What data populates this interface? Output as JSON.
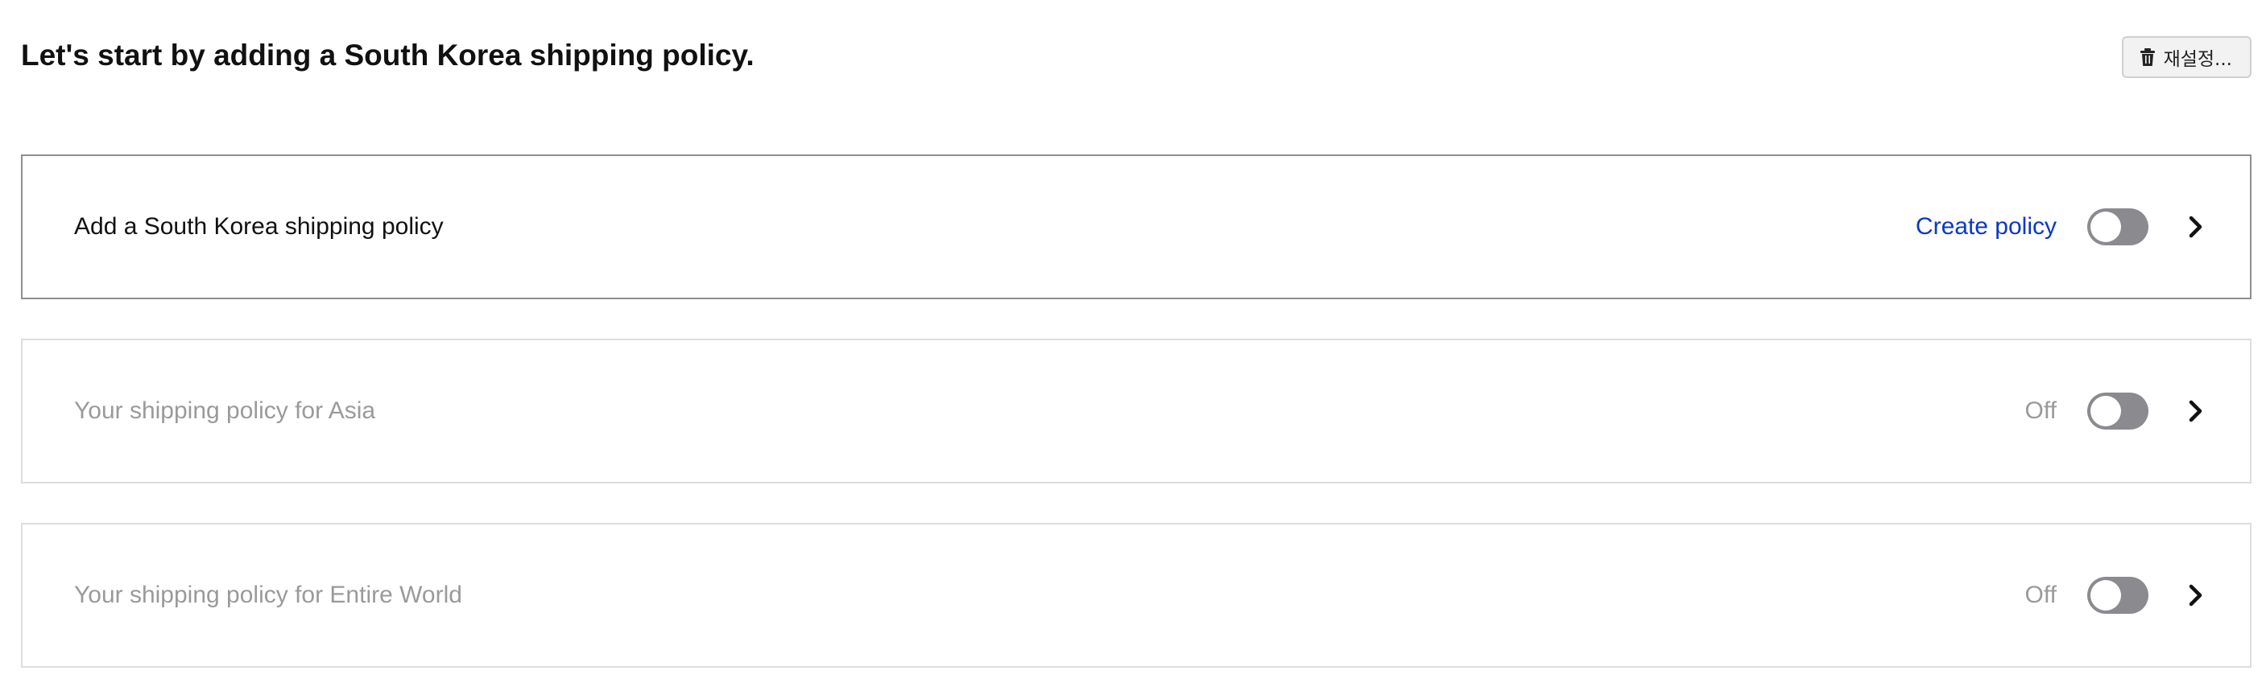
{
  "header": {
    "title": "Let's start by adding a South Korea shipping policy.",
    "reset_label": "재설정...",
    "reset_icon": "trash-icon"
  },
  "policies": [
    {
      "label": "Add a South Korea shipping policy",
      "status": "Create policy",
      "enabled": false,
      "style": "active"
    },
    {
      "label": "Your shipping policy for Asia",
      "status": "Off",
      "enabled": false,
      "style": "inactive"
    },
    {
      "label": "Your shipping policy for Entire World",
      "status": "Off",
      "enabled": false,
      "style": "inactive"
    }
  ],
  "colors": {
    "link": "#0b38c4",
    "toggle_off": "#8a8a8f",
    "muted_text": "#9a9a9a",
    "active_border": "#8f8f8f",
    "inactive_border": "#dddddd"
  }
}
